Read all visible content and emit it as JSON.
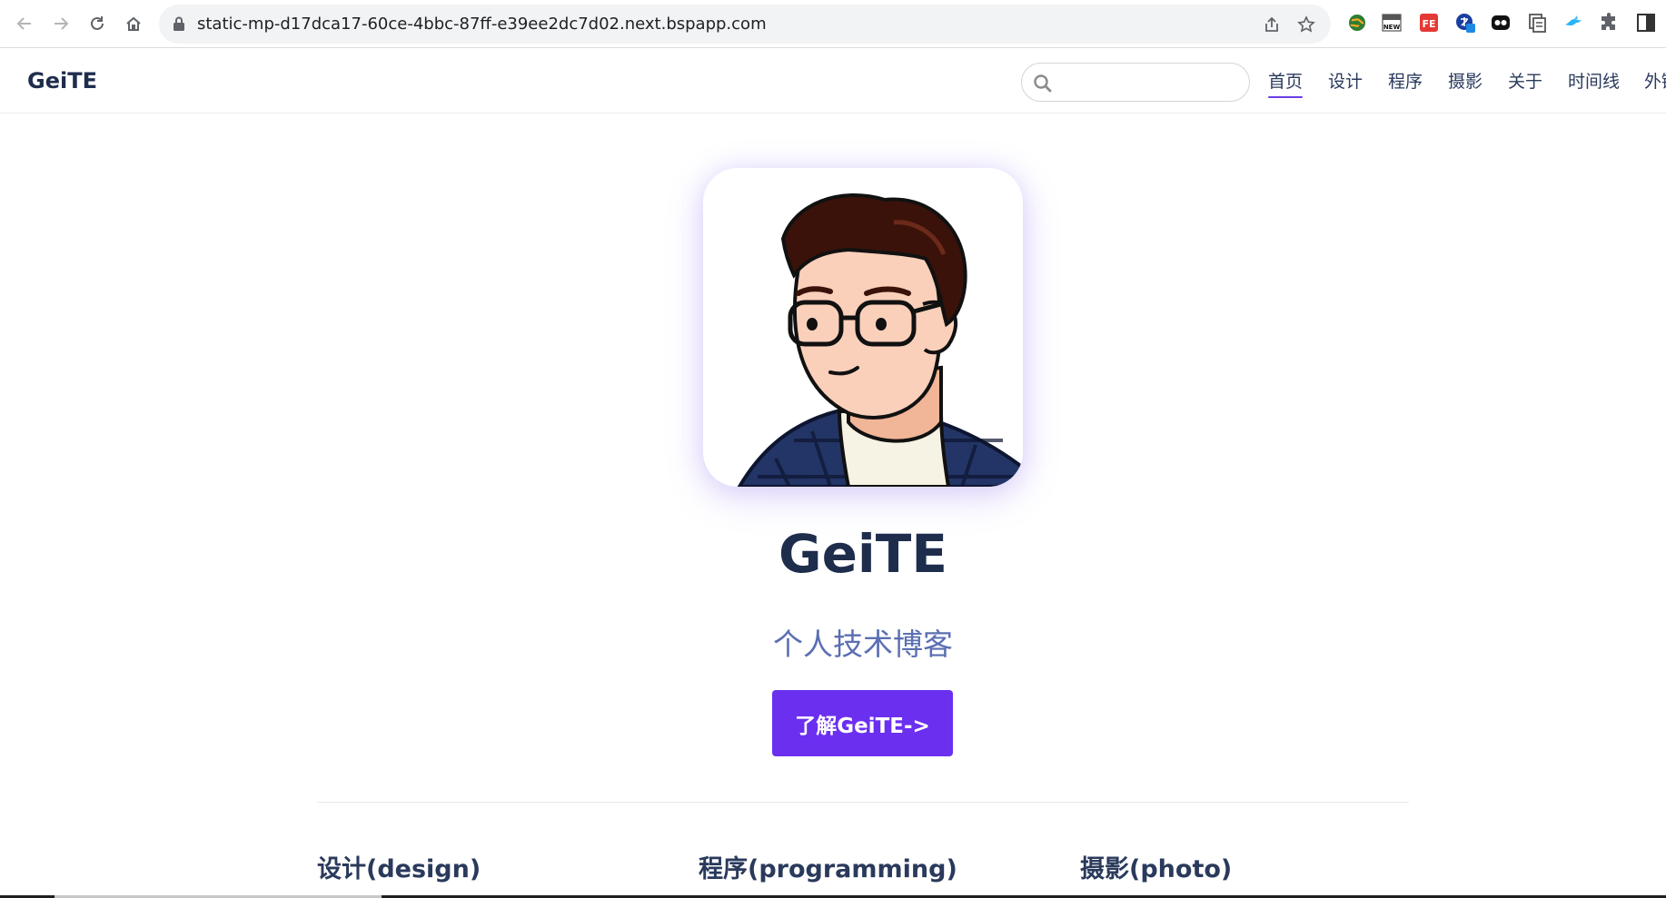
{
  "browser": {
    "url": "static-mp-d17dca17-60ce-4bbc-87ff-e39ee2dc7d02.next.bspapp.com",
    "icons": [
      "back-icon",
      "forward-icon",
      "reload-icon",
      "home-icon",
      "lock-icon",
      "share-icon",
      "bookmark-star-icon"
    ],
    "extensions": [
      "globe-extension-icon",
      "new-extension-icon",
      "fe-extension-icon",
      "translate-extension-icon",
      "dots-extension-icon",
      "copy-extension-icon",
      "bird-extension-icon",
      "puzzle-extensions-icon",
      "sidepanel-icon"
    ]
  },
  "header": {
    "brand": "GeiTE",
    "search": {
      "placeholder": "",
      "value": ""
    },
    "nav": [
      "首页",
      "设计",
      "程序",
      "摄影",
      "关于",
      "时间线",
      "外链"
    ],
    "active_nav": "首页"
  },
  "hero": {
    "title": "GeiTE",
    "subtitle": "个人技术博客",
    "cta_label": "了解GeiTE->"
  },
  "sections": [
    "设计(design)",
    "程序(programming)",
    "摄影(photo)"
  ],
  "colors": {
    "accent": "#6b2ff0",
    "title": "#1f2d4d",
    "subtitle": "#5b6fb2",
    "nav_underline": "#6b3de8"
  }
}
